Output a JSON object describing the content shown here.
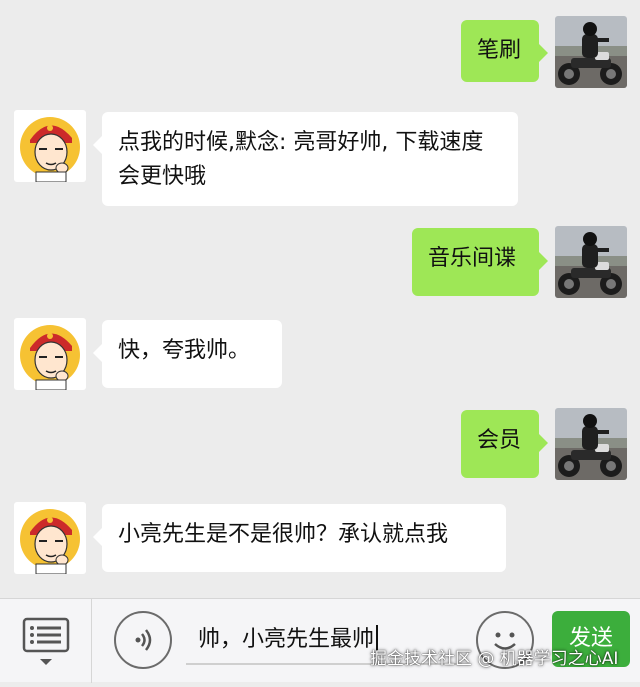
{
  "messages": [
    {
      "side": "out",
      "text": "笔刷",
      "avatar": "motorcycle-rider"
    },
    {
      "side": "in",
      "text": "点我的时候,默念: 亮哥好帅, 下载速度会更快哦",
      "avatar": "cartoon-boy-red-cap"
    },
    {
      "side": "out",
      "text": "音乐间谍",
      "avatar": "motorcycle-rider"
    },
    {
      "side": "in",
      "text": "快，夸我帅。",
      "avatar": "cartoon-boy-red-cap"
    },
    {
      "side": "out",
      "text": "会员",
      "avatar": "motorcycle-rider"
    },
    {
      "side": "in",
      "text": "小亮先生是不是很帅？承认就点我",
      "avatar": "cartoon-boy-red-cap"
    }
  ],
  "input_bar": {
    "menu_icon": "menu-list-icon",
    "voice_icon": "voice-icon",
    "text_value": "帅，小亮先生最帅",
    "emoji_icon": "emoji-icon",
    "send_label": "发送"
  },
  "watermark": "掘金技术社区 @ 机器学习之心AI",
  "colors": {
    "background": "#ececec",
    "outgoing_bubble": "#9ee756",
    "incoming_bubble": "#ffffff",
    "send_button": "#3cae3c"
  }
}
